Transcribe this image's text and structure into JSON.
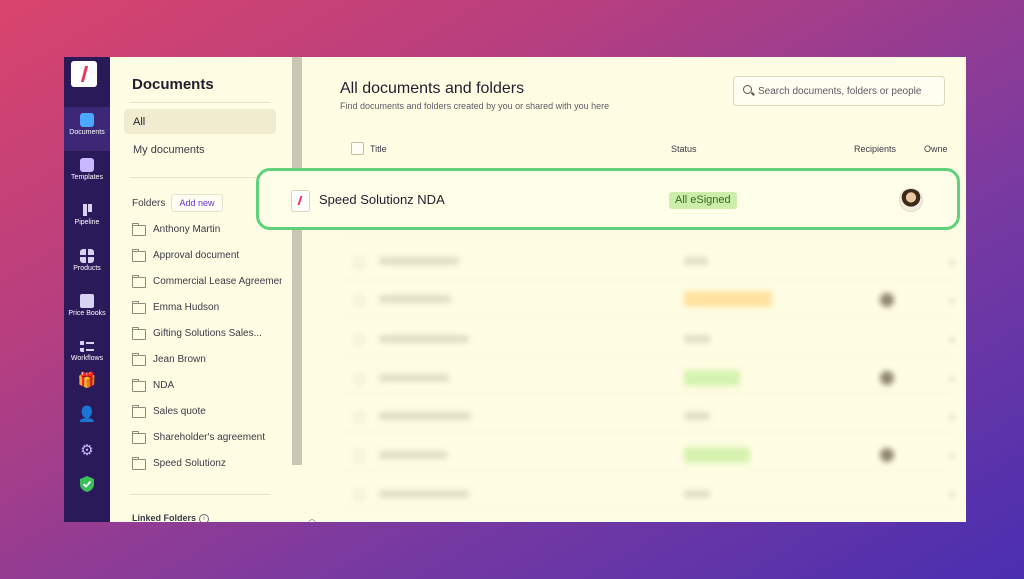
{
  "rail": {
    "items": [
      {
        "label": "Documents"
      },
      {
        "label": "Templates"
      },
      {
        "label": "Pipeline"
      },
      {
        "label": "Products"
      },
      {
        "label": "Price Books"
      },
      {
        "label": "Workflows"
      }
    ]
  },
  "panel": {
    "title": "Documents",
    "nav_all": "All",
    "nav_my": "My documents",
    "folders_label": "Folders",
    "add_new": "Add new",
    "folders": [
      "Anthony Martin",
      "Approval document",
      "Commercial Lease Agreement",
      "Emma Hudson",
      "Gifting Solutions Sales...",
      "Jean Brown",
      "NDA",
      "Sales quote",
      "Shareholder's agreement",
      "Speed Solutionz"
    ],
    "linked_folders": "Linked Folders"
  },
  "main": {
    "title": "All documents and folders",
    "subtitle": "Find documents and folders created by you or shared with you here",
    "search_placeholder": "Search documents, folders or people",
    "columns": {
      "title": "Title",
      "status": "Status",
      "recipients": "Recipients",
      "owner": "Owne"
    }
  },
  "highlight": {
    "title": "Speed Solutionz NDA",
    "status": "All eSigned"
  },
  "colors": {
    "accent_green": "#5fd17a",
    "rail_bg": "#2b1a5a",
    "brand_red": "#e83a5a"
  }
}
